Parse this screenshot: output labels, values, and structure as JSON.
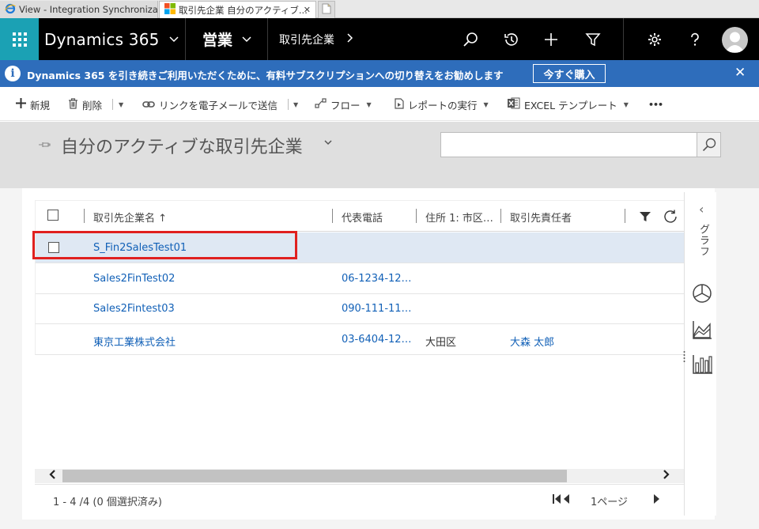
{
  "browser_tabs": [
    {
      "label": "View - Integration Synchroniza...",
      "icon": "ie-icon"
    },
    {
      "label": "取引先企業 自分のアクティブ...",
      "icon": "dynamics-icon",
      "close": "✕"
    },
    {
      "label": "",
      "icon": "new-tab-icon"
    }
  ],
  "nav": {
    "brand": "Dynamics 365",
    "area": "営業",
    "entity": "取引先企業"
  },
  "banner": {
    "message": "Dynamics 365 を引き続きご利用いただくために、有料サブスクリプションへの切り替えをお勧めします",
    "buy_label": "今すぐ購入",
    "close": "✕"
  },
  "commands": {
    "new": "新規",
    "delete": "削除",
    "email_link": "リンクを電子メールで送信",
    "flow": "フロー",
    "report": "レポートの実行",
    "excel_badge": "EXCEL",
    "excel": "EXCEL テンプレート",
    "more": "•••"
  },
  "view": {
    "title": "自分のアクティブな取引先企業",
    "search_value": ""
  },
  "grid": {
    "columns": [
      "取引先企業名 ↑",
      "代表電話",
      "住所 1: 市区…",
      "取引先責任者"
    ],
    "rows": [
      {
        "name": "S_Fin2SalesTest01",
        "phone": "",
        "city": "",
        "contact": ""
      },
      {
        "name": "Sales2FinTest02",
        "phone": "06-1234-12…",
        "city": "",
        "contact": ""
      },
      {
        "name": "Sales2Fintest03",
        "phone": "090-111-11…",
        "city": "",
        "contact": ""
      },
      {
        "name": "東京工業株式会社",
        "phone": "03-6404-12…",
        "city": "大田区",
        "contact": "大森 太郎"
      }
    ],
    "selected_row": 0
  },
  "footer": {
    "count": "1 - 4 /4 (0 個選択済み)",
    "page": "1ページ"
  },
  "sidebar": {
    "label": "グラフ",
    "collapse": "‹"
  },
  "colors": {
    "nav_bg": "#000000",
    "waffle": "#1ba1b4",
    "banner": "#2e6dbb",
    "link": "#1160b7",
    "highlight": "#e0201f"
  }
}
